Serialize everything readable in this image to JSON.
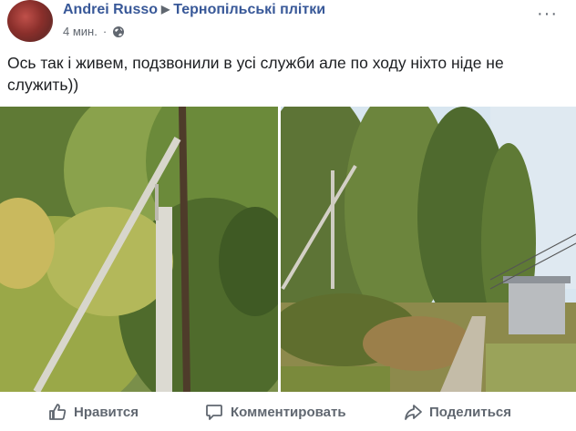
{
  "post": {
    "author": "Andrei Russo",
    "separator": "▶",
    "group": "Тернопільські плітки",
    "time": "4 мин.",
    "dot": "·",
    "more": "···",
    "text": "Ось так і живем, подзвонили в усі служби але по ходу ніхто ніде не служить))"
  },
  "actions": {
    "like": "Нравится",
    "comment": "Комментировать",
    "share": "Поделиться"
  },
  "icons": {
    "privacy": "globe-icon",
    "like": "thumbs-up-icon",
    "comment": "speech-bubble-icon",
    "share": "share-arrow-icon"
  }
}
